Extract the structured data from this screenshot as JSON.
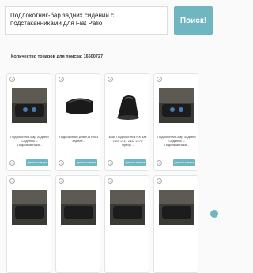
{
  "search": {
    "value": "Подлокотник-бар задних сидений с подстаканниками для Fiat Palio",
    "button_label": "Поиск!"
  },
  "results_count_text": "Количество товаров для поиска: 16600727",
  "products": [
    {
      "title": "Подлокотник-Бар Заднего Сидения С Подстаканника...",
      "button": "Детали товара",
      "info": "i",
      "image": "armrest-bar-photo"
    },
    {
      "title": "Подлокотник Для Kia Rio 3 Заднее...",
      "button": "Детали товара",
      "info": "i",
      "image": "black-armrest-box"
    },
    {
      "title": "Бокс Подлокотник На Ваз 2110 2111 2112 2170 Приор...",
      "button": "Детали товара",
      "info": "i",
      "image": "armrest-box-stand"
    },
    {
      "title": "Подлокотник-Бар Заднего Сидения С Подстаканника...",
      "button": "Детали товара",
      "info": "i",
      "image": "armrest-bar-photo"
    },
    {
      "title": "",
      "button": "",
      "info": "",
      "image": "armrest-bar-photo"
    },
    {
      "title": "",
      "button": "",
      "info": "",
      "image": "armrest-bar-photo"
    },
    {
      "title": "",
      "button": "",
      "info": "",
      "image": "armrest-bar-photo"
    },
    {
      "title": "",
      "button": "",
      "info": "",
      "image": "armrest-bar-photo"
    }
  ],
  "colors": {
    "accent": "#6fb6c1"
  }
}
